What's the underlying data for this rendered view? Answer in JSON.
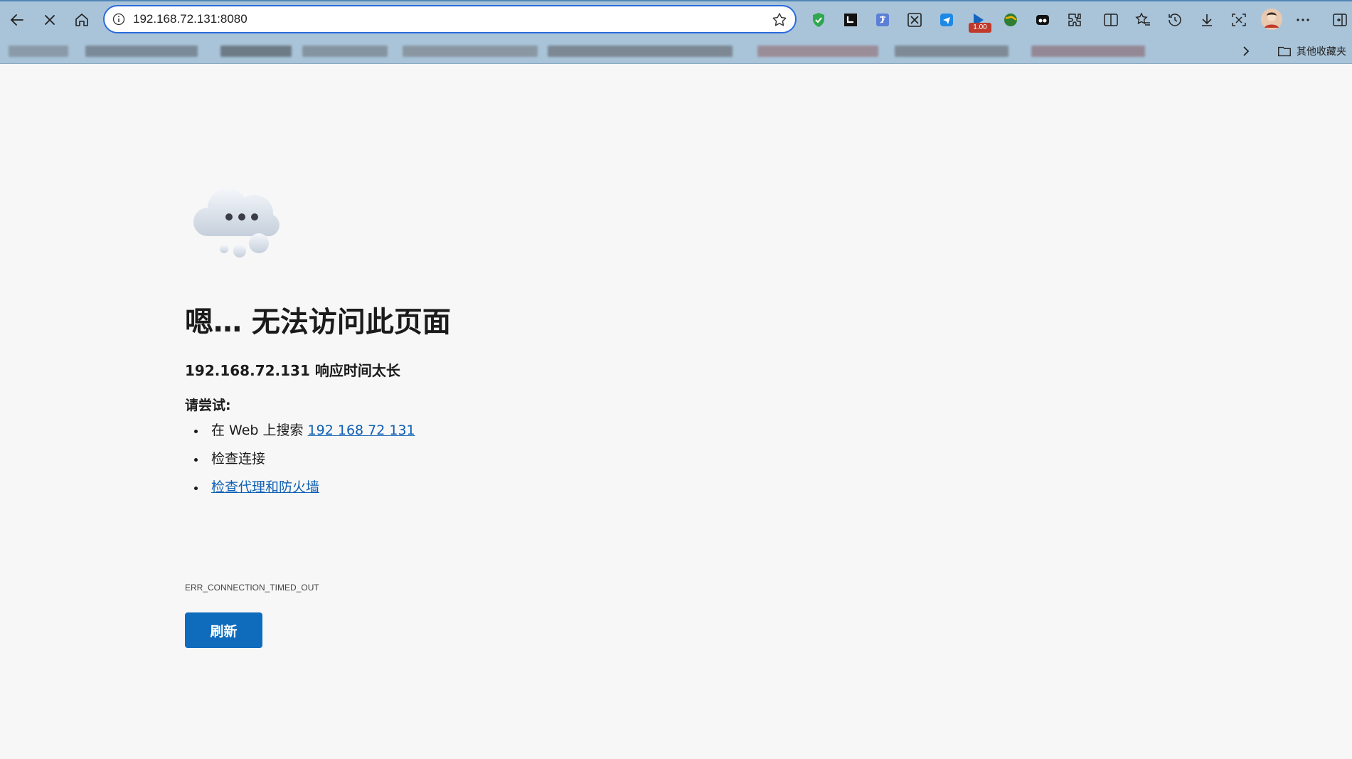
{
  "browser": {
    "address": "192.168.72.131:8080",
    "extension_badge": "1.00",
    "bookmarks_folder_label": "其他收藏夹"
  },
  "error_page": {
    "heading": "嗯… 无法访问此页面",
    "subheading": "192.168.72.131 响应时间太长",
    "try_label": "请尝试:",
    "suggestions": {
      "search_prefix": "在 Web 上搜索 ",
      "search_link": "192 168 72 131",
      "check_connection": "检查连接",
      "check_proxy": "检查代理和防火墙"
    },
    "error_code": "ERR_CONNECTION_TIMED_OUT",
    "refresh_label": "刷新"
  },
  "colors": {
    "toolbar_bg": "#a9c4d9",
    "address_border": "#2b6bdc",
    "link": "#0f5fb3",
    "button": "#0f6cbd",
    "page_bg": "#f7f7f7"
  }
}
